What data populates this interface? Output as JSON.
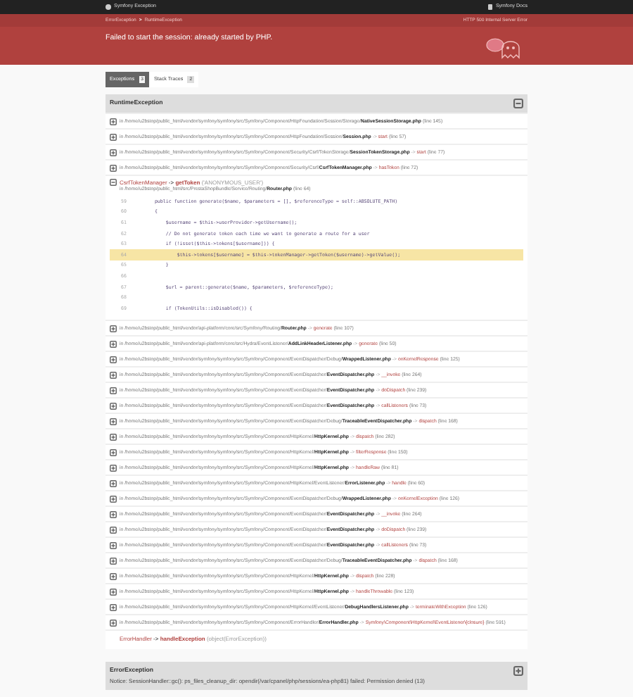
{
  "top_bar": {
    "title": "Symfony Exception",
    "link": "Symfony Docs"
  },
  "breadcrumb": {
    "items": [
      "ErrorException",
      "RuntimeException"
    ],
    "separator": ">"
  },
  "status": "HTTP 500 Internal Server Error",
  "message": "Failed to start the session: already started by PHP.",
  "tabs": [
    {
      "label": "Exceptions",
      "count": "3",
      "selected": true
    },
    {
      "label": "Stack Traces",
      "count": "2",
      "selected": false
    }
  ],
  "exceptions": [
    {
      "name": "RuntimeException",
      "expanded": true,
      "frames": [
        {
          "kind": "frame",
          "expanded": false,
          "path": "in /home/u2bstop/public_html/vendor/symfony/symfony/src/Symfony/Component/HttpFoundation/Session/Storage/",
          "file": "NativeSessionStorage.php",
          "line": "(line 145)"
        },
        {
          "kind": "frame",
          "expanded": false,
          "path": "in /home/u2bstop/public_html/vendor/symfony/symfony/src/Symfony/Component/HttpFoundation/Session/",
          "file": "Session.php",
          "arrow": "->",
          "call": "start",
          "line": "(line 57)"
        },
        {
          "kind": "frame",
          "expanded": false,
          "path": "in /home/u2bstop/public_html/vendor/symfony/symfony/src/Symfony/Component/Security/Csrf/TokenStorage/",
          "file": "SessionTokenStorage.php",
          "arrow": "->",
          "call": "start",
          "line": "(line 77)"
        },
        {
          "kind": "frame",
          "expanded": false,
          "path": "in /home/u2bstop/public_html/vendor/symfony/symfony/src/Symfony/Component/Security/Csrf/",
          "file": "CsrfTokenManager.php",
          "arrow": "->",
          "call": "hasToken",
          "line": "(line 72)"
        },
        {
          "kind": "frame",
          "expanded": true,
          "class": "CsrfTokenManager",
          "call_arrow": "->",
          "method": "getToken",
          "args": "('ANONYMOUS_USER')",
          "path": "in /home/u2bstop/public_html/src/PrestaShopBundle/Service/Routing/",
          "file": "Router.php",
          "line": "(line 64)",
          "code": [
            {
              "number": "59",
              "text": "    public function generate($name, $parameters = [], $referenceType = self::ABSOLUTE_PATH)",
              "highlighted": false
            },
            {
              "number": "60",
              "text": "    {",
              "highlighted": false
            },
            {
              "number": "61",
              "text": "        $username = $this->userProvider->getUsername();",
              "highlighted": false
            },
            {
              "number": "62",
              "text": "        // Do not generate token each time we want to generate a route for a user",
              "highlighted": false
            },
            {
              "number": "63",
              "text": "        if (!isset($this->tokens[$username])) {",
              "highlighted": false
            },
            {
              "number": "64",
              "text": "            $this->tokens[$username] = $this->tokenManager->getToken($username)->getValue();",
              "highlighted": true
            },
            {
              "number": "65",
              "text": "        }",
              "highlighted": false
            },
            {
              "number": "66",
              "highlighted": false
            },
            {
              "number": "67",
              "text": "        $url = parent::generate($name, $parameters, $referenceType);",
              "highlighted": false
            },
            {
              "number": "68",
              "highlighted": false
            },
            {
              "number": "69",
              "text": "        if (TokenUtils::isDisabled()) {",
              "highlighted": false
            }
          ]
        },
        {
          "kind": "frame",
          "expanded": false,
          "path": "in /home/u2bstop/public_html/vendor/api-platform/core/src/Symfony/Routing/",
          "file": "Router.php",
          "arrow": "->",
          "call": "generate",
          "line": "(line 107)"
        },
        {
          "kind": "frame",
          "expanded": false,
          "path": "in /home/u2bstop/public_html/vendor/api-platform/core/src/Hydra/EventListener/",
          "file": "AddLinkHeaderListener.php",
          "arrow": "->",
          "call": "generate",
          "line": "(line 50)"
        },
        {
          "kind": "frame",
          "expanded": false,
          "path": "in /home/u2bstop/public_html/vendor/symfony/symfony/src/Symfony/Component/EventDispatcher/Debug/",
          "file": "WrappedListener.php",
          "arrow": "->",
          "call": "onKernelResponse",
          "line": "(line 125)"
        },
        {
          "kind": "frame",
          "expanded": false,
          "path": "in /home/u2bstop/public_html/vendor/symfony/symfony/src/Symfony/Component/EventDispatcher/",
          "file": "EventDispatcher.php",
          "arrow": "->",
          "call": "__invoke",
          "line": "(line 264)"
        },
        {
          "kind": "frame",
          "expanded": false,
          "path": "in /home/u2bstop/public_html/vendor/symfony/symfony/src/Symfony/Component/EventDispatcher/",
          "file": "EventDispatcher.php",
          "arrow": "->",
          "call": "doDispatch",
          "line": "(line 239)"
        },
        {
          "kind": "frame",
          "expanded": false,
          "path": "in /home/u2bstop/public_html/vendor/symfony/symfony/src/Symfony/Component/EventDispatcher/",
          "file": "EventDispatcher.php",
          "arrow": "->",
          "call": "callListeners",
          "line": "(line 73)"
        },
        {
          "kind": "frame",
          "expanded": false,
          "path": "in /home/u2bstop/public_html/vendor/symfony/symfony/src/Symfony/Component/EventDispatcher/Debug/",
          "file": "TraceableEventDispatcher.php",
          "arrow": "->",
          "call": "dispatch",
          "line": "(line 168)"
        },
        {
          "kind": "frame",
          "expanded": false,
          "path": "in /home/u2bstop/public_html/vendor/symfony/symfony/src/Symfony/Component/HttpKernel/",
          "file": "HttpKernel.php",
          "arrow": "->",
          "call": "dispatch",
          "line": "(line 282)"
        },
        {
          "kind": "frame",
          "expanded": false,
          "path": "in /home/u2bstop/public_html/vendor/symfony/symfony/src/Symfony/Component/HttpKernel/",
          "file": "HttpKernel.php",
          "arrow": "->",
          "call": "filterResponse",
          "line": "(line 150)"
        },
        {
          "kind": "frame",
          "expanded": false,
          "path": "in /home/u2bstop/public_html/vendor/symfony/symfony/src/Symfony/Component/HttpKernel/",
          "file": "HttpKernel.php",
          "arrow": "->",
          "call": "handleRaw",
          "line": "(line 81)"
        },
        {
          "kind": "frame",
          "expanded": false,
          "path": "in /home/u2bstop/public_html/vendor/symfony/symfony/src/Symfony/Component/HttpKernel/EventListener/",
          "file": "ErrorListener.php",
          "arrow": "->",
          "call": "handle",
          "line": "(line 60)"
        },
        {
          "kind": "frame",
          "expanded": false,
          "path": "in /home/u2bstop/public_html/vendor/symfony/symfony/src/Symfony/Component/EventDispatcher/Debug/",
          "file": "WrappedListener.php",
          "arrow": "->",
          "call": "onKernelException",
          "line": "(line 126)"
        },
        {
          "kind": "frame",
          "expanded": false,
          "path": "in /home/u2bstop/public_html/vendor/symfony/symfony/src/Symfony/Component/EventDispatcher/",
          "file": "EventDispatcher.php",
          "arrow": "->",
          "call": "__invoke",
          "line": "(line 264)"
        },
        {
          "kind": "frame",
          "expanded": false,
          "path": "in /home/u2bstop/public_html/vendor/symfony/symfony/src/Symfony/Component/EventDispatcher/",
          "file": "EventDispatcher.php",
          "arrow": "->",
          "call": "doDispatch",
          "line": "(line 239)"
        },
        {
          "kind": "frame",
          "expanded": false,
          "path": "in /home/u2bstop/public_html/vendor/symfony/symfony/src/Symfony/Component/EventDispatcher/",
          "file": "EventDispatcher.php",
          "arrow": "->",
          "call": "callListeners",
          "line": "(line 73)"
        },
        {
          "kind": "frame",
          "expanded": false,
          "path": "in /home/u2bstop/public_html/vendor/symfony/symfony/src/Symfony/Component/EventDispatcher/Debug/",
          "file": "TraceableEventDispatcher.php",
          "arrow": "->",
          "call": "dispatch",
          "line": "(line 168)"
        },
        {
          "kind": "frame",
          "expanded": false,
          "path": "in /home/u2bstop/public_html/vendor/symfony/symfony/src/Symfony/Component/HttpKernel/",
          "file": "HttpKernel.php",
          "arrow": "->",
          "call": "dispatch",
          "line": "(line 228)"
        },
        {
          "kind": "frame",
          "expanded": false,
          "path": "in /home/u2bstop/public_html/vendor/symfony/symfony/src/Symfony/Component/HttpKernel/",
          "file": "HttpKernel.php",
          "arrow": "->",
          "call": "handleThrowable",
          "line": "(line 123)"
        },
        {
          "kind": "frame",
          "expanded": false,
          "path": "in /home/u2bstop/public_html/vendor/symfony/symfony/src/Symfony/Component/HttpKernel/EventListener/",
          "file": "DebugHandlersListener.php",
          "arrow": "->",
          "call": "terminateWithException",
          "line": "(line 126)"
        },
        {
          "kind": "frame",
          "expanded": false,
          "path": "in /home/u2bstop/public_html/vendor/symfony/symfony/src/Symfony/Component/ErrorHandler/",
          "file": "ErrorHandler.php",
          "arrow": "->",
          "call": "Symfony\\Component\\HttpKernel\\EventListener\\{closure}",
          "line": "(line 591)"
        },
        {
          "kind": "call",
          "class": "ErrorHandler",
          "call_arrow": "->",
          "method": "handleException",
          "args": "(object(ErrorException))"
        }
      ]
    },
    {
      "name": "ErrorException",
      "expanded": false,
      "message": "Notice: SessionHandler::gc(): ps_files_cleanup_dir: opendir(/var/cpanel/php/sessions/ea-php81) failed: Permission denied (13)"
    }
  ]
}
